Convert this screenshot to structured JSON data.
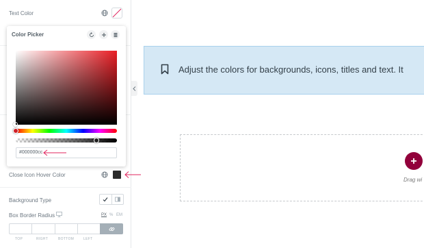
{
  "panel": {
    "text_color_label": "Text Color",
    "close_icon_hover_label": "Close Icon Hover Color",
    "background_type_label": "Background Type",
    "box_border_radius_label": "Box Border Radius",
    "units": [
      "PX",
      "%",
      "EM"
    ],
    "dimensions": [
      "TOP",
      "RIGHT",
      "BOTTOM",
      "LEFT"
    ]
  },
  "picker": {
    "title": "Color Picker",
    "hex_value": "#000000cc"
  },
  "canvas": {
    "notice_text": "Adjust the colors for backgrounds, icons, titles and text. It",
    "drag_text": "Drag wi"
  },
  "icons": {
    "globe": "globe-icon",
    "reset": "reset-icon",
    "add": "plus-icon",
    "library": "library-icon",
    "bookmark": "bookmark-icon",
    "desktop": "desktop-icon",
    "link": "link-icon",
    "collapse": "chevron-left-icon",
    "check": "check-icon"
  },
  "colors": {
    "accent_arrow": "#e0245e",
    "add_button": "#92003b",
    "notice_bg": "#d5e8f5",
    "hover_swatch": "#2b2b2b"
  }
}
